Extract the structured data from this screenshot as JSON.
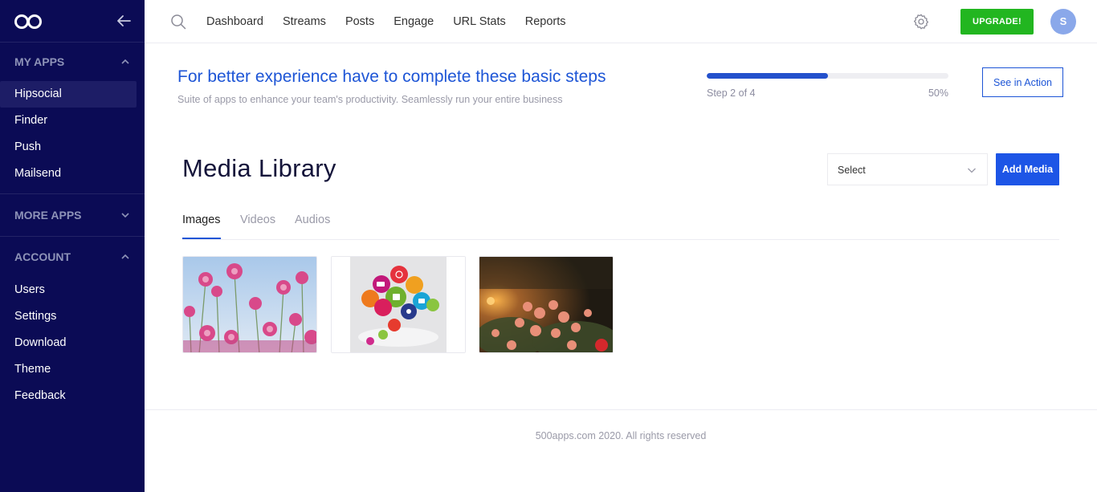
{
  "sidebar": {
    "my_apps": {
      "heading": "MY APPS",
      "items": [
        "Hipsocial",
        "Finder",
        "Push",
        "Mailsend"
      ],
      "active": "Hipsocial"
    },
    "more_apps": {
      "heading": "MORE APPS"
    },
    "account": {
      "heading": "ACCOUNT",
      "items": [
        "Users",
        "Settings",
        "Download",
        "Theme",
        "Feedback"
      ]
    }
  },
  "topbar": {
    "nav": [
      "Dashboard",
      "Streams",
      "Posts",
      "Engage",
      "URL Stats",
      "Reports"
    ],
    "upgrade_label": "UPGRADE!",
    "avatar_initial": "S"
  },
  "steps": {
    "title": "For better experience have to complete these basic steps",
    "subtitle": "Suite of apps to enhance your team's productivity. Seamlessly run your entire business",
    "progress_percent": 50,
    "step_label": "Step 2 of 4",
    "percent_label": "50%",
    "see_action_label": "See in Action"
  },
  "media_library": {
    "title": "Media Library",
    "select_value": "Select",
    "add_label": "Add Media",
    "tabs": [
      "Images",
      "Videos",
      "Audios"
    ],
    "active_tab": "Images"
  },
  "footer": {
    "text": "500apps.com 2020. All rights reserved"
  },
  "colors": {
    "sidebar_bg": "#0b0b55",
    "accent_blue": "#1d55d6",
    "upgrade_green": "#22b620",
    "avatar_bg": "#8aa8ea"
  }
}
